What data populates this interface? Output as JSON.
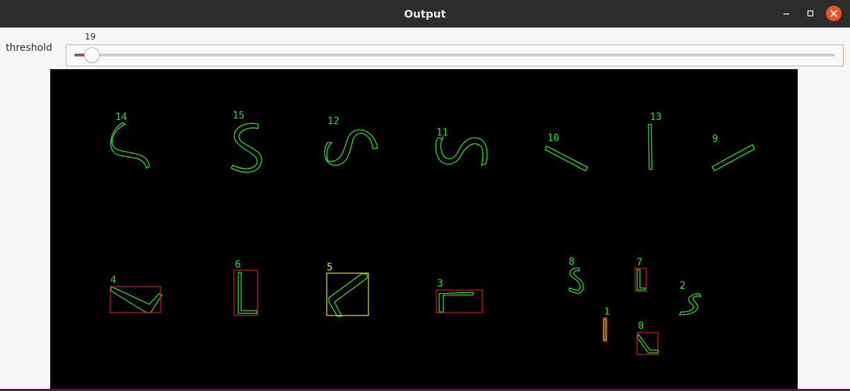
{
  "window": {
    "title": "Output"
  },
  "controls": {
    "threshold_label": "threshold",
    "threshold_value": "19",
    "threshold_fraction": 0.022
  },
  "colors": {
    "contour": "#22e022",
    "box_red": "#d01a1a",
    "box_yellow": "#e8e020",
    "label_green": "#22e022",
    "label_yellow": "#e8e020",
    "slider_fill": "#924d8b",
    "close_button": "#e95420"
  },
  "shapes": {
    "labels": [
      "0",
      "1",
      "2",
      "3",
      "4",
      "5",
      "6",
      "7",
      "8",
      "9",
      "10",
      "11",
      "12",
      "13",
      "14",
      "15"
    ]
  }
}
